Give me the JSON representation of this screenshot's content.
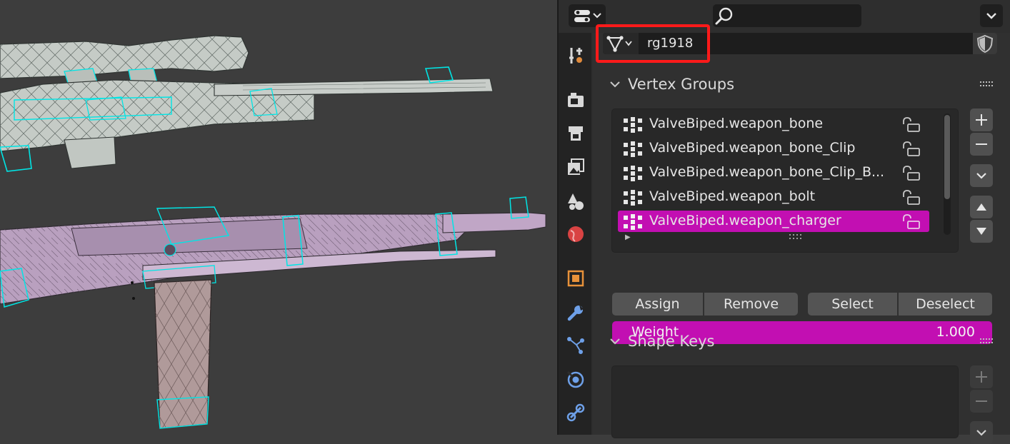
{
  "viewport": {
    "colors": {
      "background": "#3d3d3d",
      "rifle_top": "#c5cbc6",
      "rifle_bottom": "#b9a0bf",
      "magazine": "#b09a9a",
      "wire_selected": "#00e5e5"
    }
  },
  "header": {
    "editor_type_icon": "editor-type-icon",
    "search_placeholder": "",
    "search_icon": "search-icon",
    "options_icon": "chevron-down-icon"
  },
  "tabs": [
    {
      "name": "tool",
      "icon": "tool-icon"
    },
    {
      "name": "render",
      "icon": "render-icon"
    },
    {
      "name": "output",
      "icon": "output-icon"
    },
    {
      "name": "view-layer",
      "icon": "view-layer-icon"
    },
    {
      "name": "scene",
      "icon": "scene-icon"
    },
    {
      "name": "world",
      "icon": "world-icon"
    },
    {
      "name": "object",
      "icon": "object-icon"
    },
    {
      "name": "modifiers",
      "icon": "wrench-icon"
    },
    {
      "name": "particles",
      "icon": "particles-icon"
    },
    {
      "name": "physics",
      "icon": "physics-icon"
    },
    {
      "name": "constraints",
      "icon": "constraints-icon"
    }
  ],
  "data_block": {
    "type_icon": "mesh-data-icon",
    "name": "rg1918",
    "fake_user_icon": "shield-icon"
  },
  "vertex_groups": {
    "title": "Vertex Groups",
    "items": [
      {
        "label": "ValveBiped.weapon_bone",
        "active": false
      },
      {
        "label": "ValveBiped.weapon_bone_Clip",
        "active": false
      },
      {
        "label": "ValveBiped.weapon_bone_Clip_B...",
        "active": false
      },
      {
        "label": "ValveBiped.weapon_bolt",
        "active": false
      },
      {
        "label": "ValveBiped.weapon_charger",
        "active": true
      }
    ],
    "assign_label": "Assign",
    "remove_label": "Remove",
    "select_label": "Select",
    "deselect_label": "Deselect",
    "weight_label": "Weight",
    "weight_value": "1.000",
    "active_color": "#c20fb2"
  },
  "shape_keys": {
    "title": "Shape Keys"
  }
}
